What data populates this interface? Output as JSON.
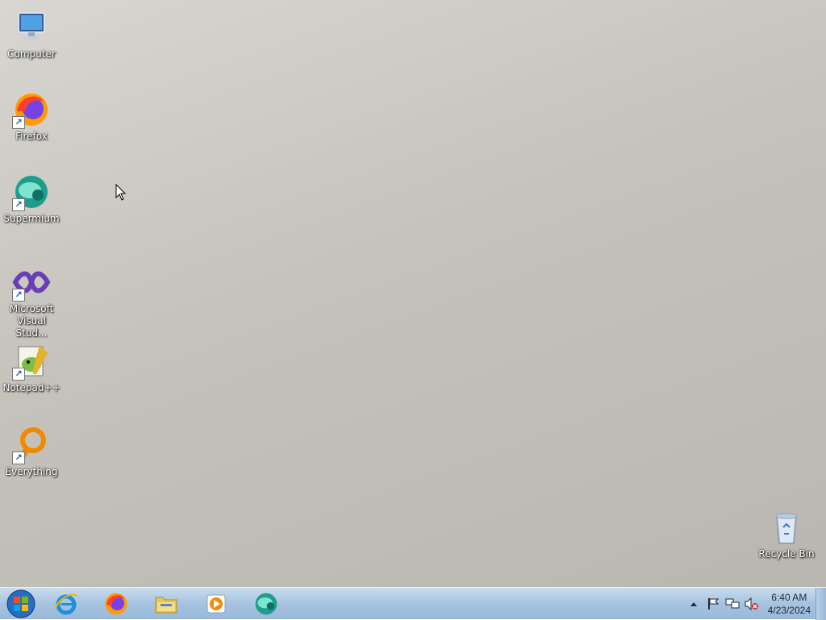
{
  "desktop": {
    "icons": [
      {
        "label": "Computer",
        "icon": "computer-icon"
      },
      {
        "label": "Firefox",
        "icon": "firefox-icon"
      },
      {
        "label": "Supermium",
        "icon": "supermium-icon"
      },
      {
        "label": "Microsoft Visual Stud...",
        "icon": "visual-studio-icon"
      },
      {
        "label": "Notepad++",
        "icon": "notepadpp-icon"
      },
      {
        "label": "Everything",
        "icon": "everything-icon"
      }
    ],
    "recycle_bin": {
      "label": "Recycle Bin",
      "icon": "recycle-bin-icon"
    }
  },
  "taskbar": {
    "start": "windows-logo-icon",
    "pinned": [
      {
        "name": "Internet Explorer",
        "icon": "internet-explorer-icon"
      },
      {
        "name": "Firefox",
        "icon": "firefox-icon"
      },
      {
        "name": "Windows Explorer",
        "icon": "folder-icon"
      },
      {
        "name": "Windows Media Player",
        "icon": "media-player-icon"
      },
      {
        "name": "Supermium",
        "icon": "supermium-icon"
      }
    ],
    "tray": {
      "icons": [
        "show-hidden-icons-icon",
        "action-center-flag-icon",
        "network-icon",
        "volume-muted-icon"
      ],
      "time": "6:40 AM",
      "date": "4/23/2024"
    }
  }
}
